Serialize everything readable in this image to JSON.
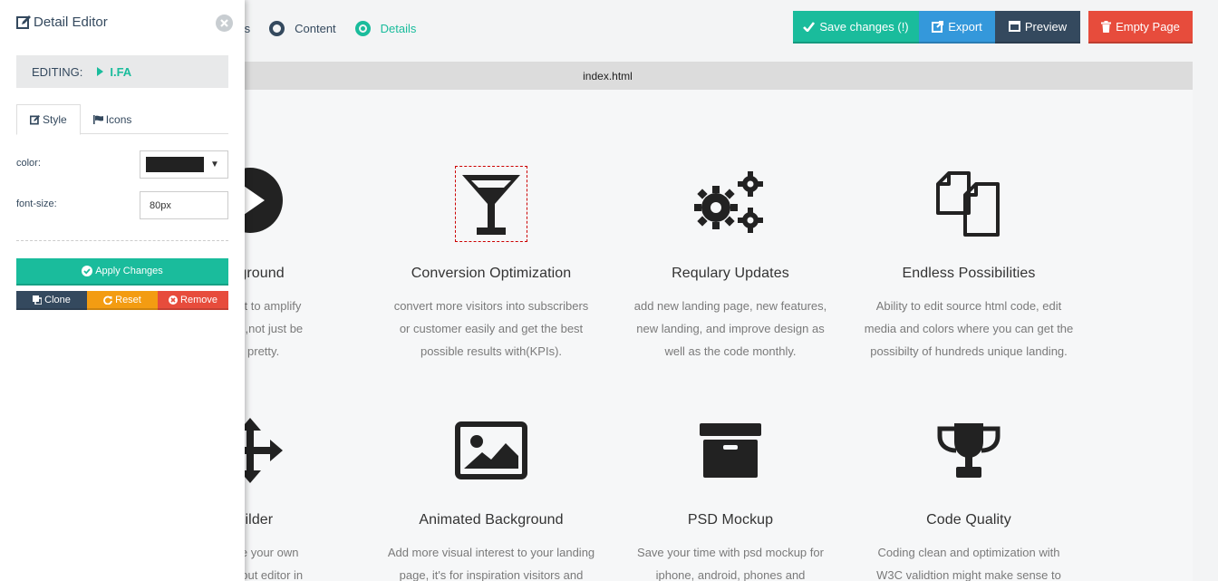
{
  "steps": [
    {
      "label": "ts",
      "active": false
    },
    {
      "label": "Content",
      "active": false
    },
    {
      "label": "Details",
      "active": true
    }
  ],
  "toolbar": {
    "save": "Save changes (!)",
    "export": "Export",
    "preview": "Preview",
    "empty": "Empty Page"
  },
  "file": {
    "name": "index.html"
  },
  "features": [
    {
      "title": "ackground",
      "desc": [
        "d content to amplify",
        "message,not just be",
        "s it's pretty."
      ]
    },
    {
      "title": "Conversion Optimization",
      "desc": [
        "convert more visitors into subscribers",
        "or customer easily and get the best",
        "possible results with(KPIs)."
      ]
    },
    {
      "title": "Requlary Updates",
      "desc": [
        "add new landing page, new features,",
        "new landing, and improve design as",
        "well as the code monthly."
      ]
    },
    {
      "title": "Endless Possibilities",
      "desc": [
        "Ability to edit source html code, edit",
        "media and colors where you can get the",
        "possibilty of hundreds unique landing."
      ]
    },
    {
      "title": "Builder",
      "desc": [
        "to create your own",
        "age without editor in"
      ]
    },
    {
      "title": "Animated Background",
      "desc": [
        "Add more visual interest to your landing",
        "page, it's for inspiration visitors and"
      ]
    },
    {
      "title": "PSD Mockup",
      "desc": [
        "Save your time with psd mockup for",
        "iphone, android, phones and"
      ]
    },
    {
      "title": "Code Quality",
      "desc": [
        "Coding clean and optimization with",
        "W3C validtion might make sense to"
      ]
    }
  ],
  "icons": [
    "play-circle-icon",
    "cocktail-glass-icon",
    "gears-icon",
    "copy-files-icon",
    "arrows-move-icon",
    "picture-icon",
    "archive-box-icon",
    "trophy-icon"
  ],
  "editor": {
    "title": "Detail Editor",
    "editing_label": "EDITING:",
    "editing_tag": "I.FA",
    "tabs": {
      "style": "Style",
      "icons": "Icons"
    },
    "color_label": "color:",
    "color_value": "#222222",
    "font_size_label": "font-size:",
    "font_size_value": "80px",
    "apply": "Apply Changes",
    "clone": "Clone",
    "reset": "Reset",
    "remove": "Remove"
  },
  "colors": {
    "accent": "#1abc9c",
    "blue": "#3498db",
    "navy": "#34495e",
    "red": "#e74c3c",
    "orange": "#f39c12"
  }
}
